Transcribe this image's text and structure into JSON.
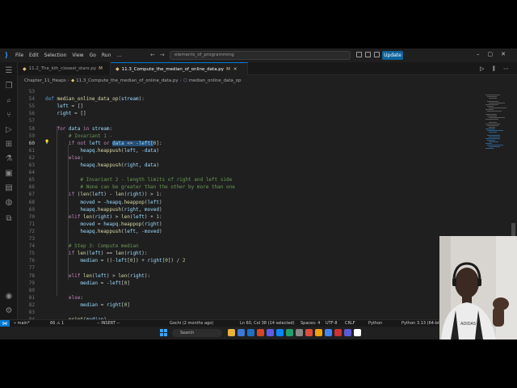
{
  "titlebar": {
    "menu": [
      "File",
      "Edit",
      "Selection",
      "View",
      "Go",
      "Run",
      "…"
    ],
    "search_text": "elements_of_programming",
    "update_label": "Update"
  },
  "tabs": [
    {
      "label": "11.2_The_kth_closest_stars.py",
      "modified": "M",
      "active": false
    },
    {
      "label": "11.3_Compute_the_median_of_online_data.py",
      "modified": "M",
      "active": true
    }
  ],
  "breadcrumb": [
    "Chapter_11_Heaps",
    "11.3_Compute_the_median_of_online_data.py",
    "median_online_data_op"
  ],
  "code_lines": [
    {
      "n": "53",
      "t": ""
    },
    {
      "n": "54",
      "t": "def median_online_data_op(stream):"
    },
    {
      "n": "55",
      "t": "    left = []"
    },
    {
      "n": "56",
      "t": "    right = []"
    },
    {
      "n": "57",
      "t": ""
    },
    {
      "n": "58",
      "t": "    for data in stream:"
    },
    {
      "n": "59",
      "t": "        # Invariant 1 -"
    },
    {
      "n": "60",
      "t": "        if not left or data <= -left[0]:"
    },
    {
      "n": "61",
      "t": "            heapq.heappush(left, -data)"
    },
    {
      "n": "62",
      "t": "        else:"
    },
    {
      "n": "63",
      "t": "            heapq.heappush(right, data)"
    },
    {
      "n": "64",
      "t": ""
    },
    {
      "n": "65",
      "t": "            # Invariant 2 - length limits of right and left side"
    },
    {
      "n": "66",
      "t": "            # None can be greater than the other by more than one"
    },
    {
      "n": "67",
      "t": "        if (len(left) - len(right)) > 1:"
    },
    {
      "n": "68",
      "t": "            moved = -heapq.heappop(left)"
    },
    {
      "n": "69",
      "t": "            heapq.heappush(right, moved)"
    },
    {
      "n": "70",
      "t": "        elif len(right) > len(left) + 1:"
    },
    {
      "n": "71",
      "t": "            moved = heapq.heappop(right)"
    },
    {
      "n": "72",
      "t": "            heapq.heappush(left, -moved)"
    },
    {
      "n": "73",
      "t": ""
    },
    {
      "n": "74",
      "t": "        # Step 3: Compute median"
    },
    {
      "n": "75",
      "t": "        if len(left) == len(right):"
    },
    {
      "n": "76",
      "t": "            median = ((-left[0]) + right[0]) / 2"
    },
    {
      "n": "77",
      "t": ""
    },
    {
      "n": "78",
      "t": "        elif len(left) > len(right):"
    },
    {
      "n": "79",
      "t": "            median = -left[0]"
    },
    {
      "n": "80",
      "t": ""
    },
    {
      "n": "81",
      "t": "        else:"
    },
    {
      "n": "82",
      "t": "            median = right[0]"
    },
    {
      "n": "83",
      "t": ""
    },
    {
      "n": "84",
      "t": "        print(median)"
    }
  ],
  "statusbar": {
    "branch": "main*",
    "problems": "66 ⚠ 1",
    "mode": "-- INSERT --",
    "blame": "Gochi (2 months ago)",
    "cursor": "Ln 60, Col 38 (14 selected)",
    "spaces": "Spaces: 4",
    "encoding": "UTF-8",
    "eol": "CRLF",
    "language": "Python",
    "interpreter": "Python 3.13 (64-bit)"
  },
  "taskbar": {
    "search_placeholder": "Search"
  },
  "colors": {
    "accent": "#0078d4",
    "editor_bg": "#1f1f1f",
    "selection": "#264f78"
  }
}
